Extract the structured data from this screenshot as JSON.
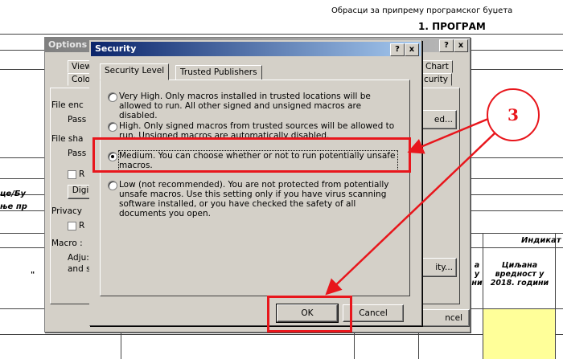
{
  "spreadsheet": {
    "title": "Обрасци за припрему програмског буџета",
    "heading": "1. ПРОГРАМ",
    "left_label_1": "це/Бу",
    "left_label_2": "ње пр",
    "left_label_3": "\"",
    "col_header_indicator": "Индикат",
    "col_header_target": [
      "Циљана",
      "вредност у",
      "2018. години"
    ],
    "col_header_small": [
      "а",
      "у",
      "ни"
    ]
  },
  "options_dialog": {
    "title": "Options",
    "close_glyph": "x",
    "help_glyph": "?",
    "tab_view": "View",
    "tab_color": "Colo",
    "tab_chart": "Chart",
    "tab_security": "curity",
    "file_encryption": "File enc",
    "password_open": "Pass",
    "file_sharing": "File sha",
    "password_modify": "Pass",
    "read_only_label": "R",
    "digital_button": "Digi",
    "privacy_label": "Privacy",
    "remove_label": "R",
    "macro_label": "Macro :",
    "adjust_text_1": "Adju:",
    "adjust_text_2": "and s",
    "advanced_button": "ed...",
    "macro_security_button": "ity...",
    "cancel_button": "ncel"
  },
  "security_dialog": {
    "title": "Security",
    "help_glyph": "?",
    "close_glyph": "x",
    "tabs": [
      "Security Level",
      "Trusted Publishers"
    ],
    "options": [
      {
        "label": "Very High. Only macros installed in trusted locations will be allowed to run. All other signed and unsigned macros are disabled.",
        "selected": false
      },
      {
        "label": "High. Only signed macros from trusted sources will be allowed to run. Unsigned macros are automatically disabled.",
        "selected": false
      },
      {
        "label": "Medium. You can choose whether or not to run potentially unsafe macros.",
        "selected": true
      },
      {
        "label": "Low (not recommended). You are not protected from potentially unsafe macros. Use this setting only if you have virus scanning software installed, or you have checked the safety of all documents you open.",
        "selected": false
      }
    ],
    "ok_button": "OK",
    "cancel_button": "Cancel"
  },
  "annotation": {
    "step_number": "3",
    "color": "#e8161c"
  }
}
